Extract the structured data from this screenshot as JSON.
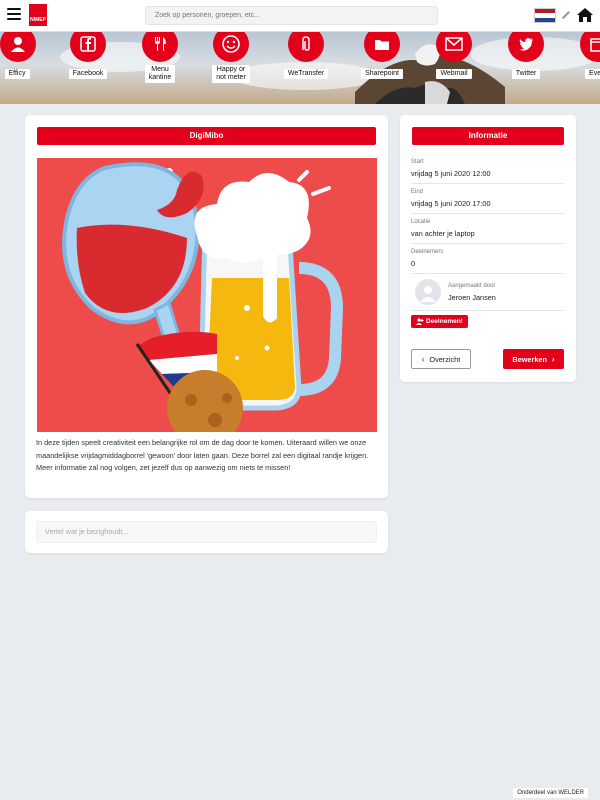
{
  "header": {
    "logo_text": "NIMEP",
    "search_placeholder": "Zoek op personen, groepen, etc...",
    "flag_colors": [
      "#ae1c28",
      "#ffffff",
      "#21468b"
    ]
  },
  "tiles": [
    {
      "label": "Efficy",
      "icon": "user-icon"
    },
    {
      "label": "Facebook",
      "icon": "facebook-icon"
    },
    {
      "label": "Menu\nkantine",
      "icon": "cutlery-icon"
    },
    {
      "label": "Happy or\nnot meter",
      "icon": "smiley-icon"
    },
    {
      "label": "WeTransfer",
      "icon": "paperclip-icon"
    },
    {
      "label": "Sharepoint",
      "icon": "folder-icon"
    },
    {
      "label": "Webmail",
      "icon": "mail-icon"
    },
    {
      "label": "Twitter",
      "icon": "twitter-icon"
    },
    {
      "label": "Event",
      "icon": "calendar-icon"
    }
  ],
  "event": {
    "title": "DigiMibo",
    "description": "In deze tijden speelt creativiteit een belangrijke rol om de dag door te komen. Uiteraard willen we onze maandelijkse vrijdagmiddagborrel 'gewoon' door laten gaan. Deze borrel zal een digitaal randje krijgen. Meer informatie zal nog volgen, zet jezelf dus op aanwezig om niets te missen!"
  },
  "info": {
    "title": "Informatie",
    "start_label": "Start",
    "start_value": "vrijdag 5 juni 2020 12:00",
    "end_label": "Eind",
    "end_value": "vrijdag 5 juni 2020 17:00",
    "location_label": "Locatie",
    "location_value": "van achter je laptop",
    "participants_label": "Deelnemers",
    "participants_value": "0",
    "created_by_label": "Aangemaakt door",
    "created_by_value": "Jeroen Jansen",
    "join_button": "Deelnemen!",
    "overview_button": "Overzicht",
    "edit_button": "Bewerken"
  },
  "post": {
    "placeholder": "Vertel wat je bezighoudt..."
  },
  "footer": {
    "text": "Onderdeel van WELDER"
  },
  "colors": {
    "accent": "#e2001a",
    "background": "#e9ecef"
  }
}
